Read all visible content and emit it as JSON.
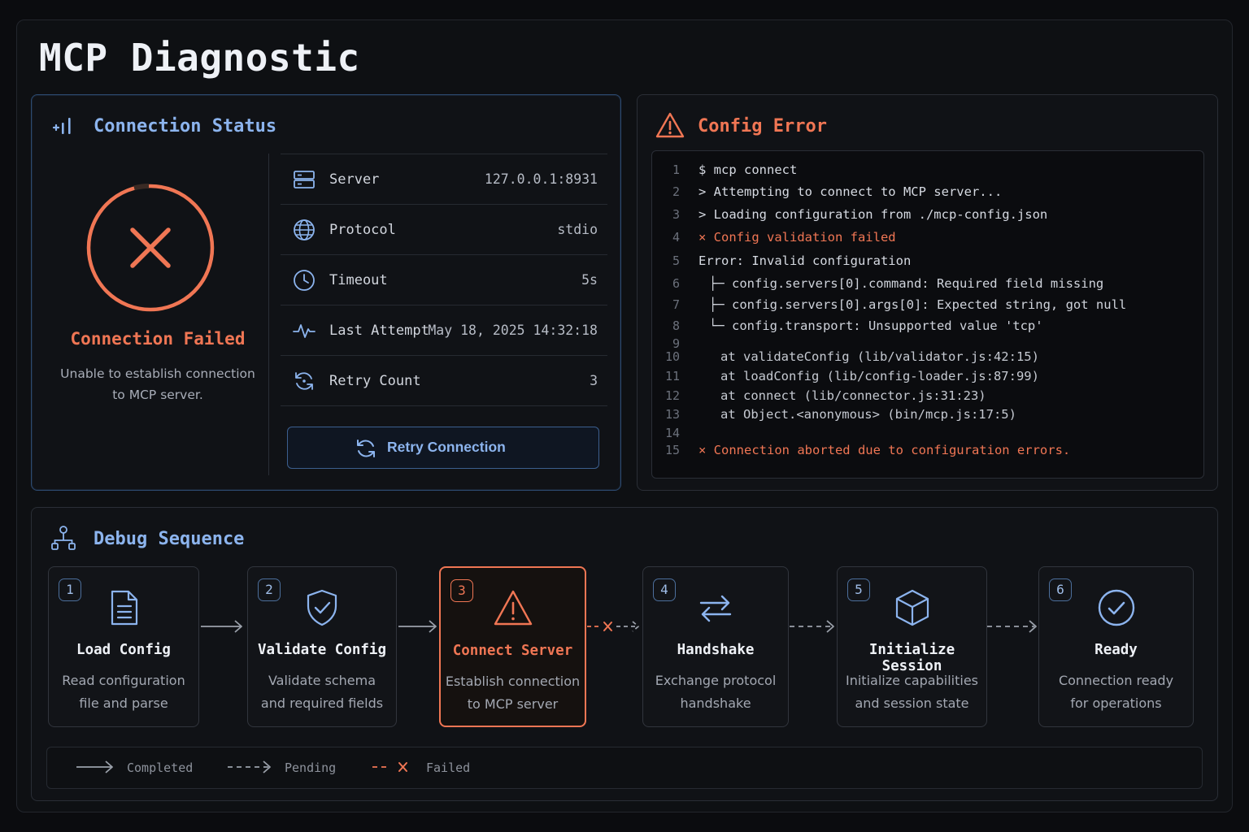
{
  "page": {
    "title": "MCP Diagnostic"
  },
  "colors": {
    "accent": "#8cb4ee",
    "error": "#f07654",
    "background": "#0b0c0f"
  },
  "status": {
    "title": "Connection Status",
    "title_icon": "signal-bars-icon",
    "state_label": "Connection Failed",
    "state_description_line1": "Unable to establish connection",
    "state_description_line2": "to MCP server.",
    "rows": [
      {
        "icon": "server-icon",
        "label": "Server",
        "value": "127.0.0.1:8931"
      },
      {
        "icon": "globe-icon",
        "label": "Protocol",
        "value": "stdio"
      },
      {
        "icon": "clock-icon",
        "label": "Timeout",
        "value": "5s"
      },
      {
        "icon": "pulse-icon",
        "label": "Last Attempt",
        "value": "May 18, 2025 14:32:18"
      },
      {
        "icon": "retry-icon",
        "label": "Retry Count",
        "value": "3"
      }
    ],
    "retry_button": "Retry Connection"
  },
  "config": {
    "title": "Config Error",
    "title_icon": "warning-icon",
    "lines": [
      {
        "n": "1",
        "text": "$ mcp connect",
        "kind": "normal"
      },
      {
        "n": "2",
        "text": "> Attempting to connect to MCP server...",
        "kind": "normal"
      },
      {
        "n": "3",
        "text": "> Loading configuration from ./mcp-config.json",
        "kind": "normal"
      },
      {
        "n": "4",
        "text": "× Config validation failed",
        "kind": "err"
      },
      {
        "n": "5",
        "text": "Error: Invalid configuration",
        "kind": "normal"
      },
      {
        "n": "6",
        "text": "├─ config.servers[0].command: Required field missing",
        "kind": "tree"
      },
      {
        "n": "7",
        "text": "├─ config.servers[0].args[0]: Expected string, got null",
        "kind": "tree"
      },
      {
        "n": "8",
        "text": "└─ config.transport: Unsupported value 'tcp'",
        "kind": "tree"
      },
      {
        "n": "9",
        "text": "",
        "kind": "normal"
      },
      {
        "n": "10",
        "text": "at validateConfig (lib/validator.js:42:15)",
        "kind": "stack"
      },
      {
        "n": "11",
        "text": "at loadConfig (lib/config-loader.js:87:99)",
        "kind": "stack"
      },
      {
        "n": "12",
        "text": "at connect (lib/connector.js:31:23)",
        "kind": "stack"
      },
      {
        "n": "13",
        "text": "at Object.<anonymous> (bin/mcp.js:17:5)",
        "kind": "stack"
      },
      {
        "n": "14",
        "text": "",
        "kind": "normal"
      },
      {
        "n": "15",
        "text": "× Connection aborted due to configuration errors.",
        "kind": "err"
      }
    ]
  },
  "debug": {
    "title": "Debug Sequence",
    "title_icon": "sitemap-icon",
    "steps": [
      {
        "num": "1",
        "icon": "document-icon",
        "name": "Load Config",
        "desc1": "Read configuration",
        "desc2": "file and parse",
        "state": "completed"
      },
      {
        "num": "2",
        "icon": "shield-check-icon",
        "name": "Validate Config",
        "desc1": "Validate schema",
        "desc2": "and required fields",
        "state": "completed"
      },
      {
        "num": "3",
        "icon": "warning-icon",
        "name": "Connect Server",
        "desc1": "Establish connection",
        "desc2": "to MCP server",
        "state": "failed"
      },
      {
        "num": "4",
        "icon": "swap-arrows-icon",
        "name": "Handshake",
        "desc1": "Exchange protocol",
        "desc2": "handshake",
        "state": "pending"
      },
      {
        "num": "5",
        "icon": "cube-icon",
        "name": "Initialize Session",
        "desc1": "Initialize capabilities",
        "desc2": "and session state",
        "state": "pending"
      },
      {
        "num": "6",
        "icon": "check-circle-icon",
        "name": "Ready",
        "desc1": "Connection ready",
        "desc2": "for operations",
        "state": "pending"
      }
    ],
    "legend": {
      "completed": "Completed",
      "pending": "Pending",
      "failed": "Failed"
    }
  }
}
